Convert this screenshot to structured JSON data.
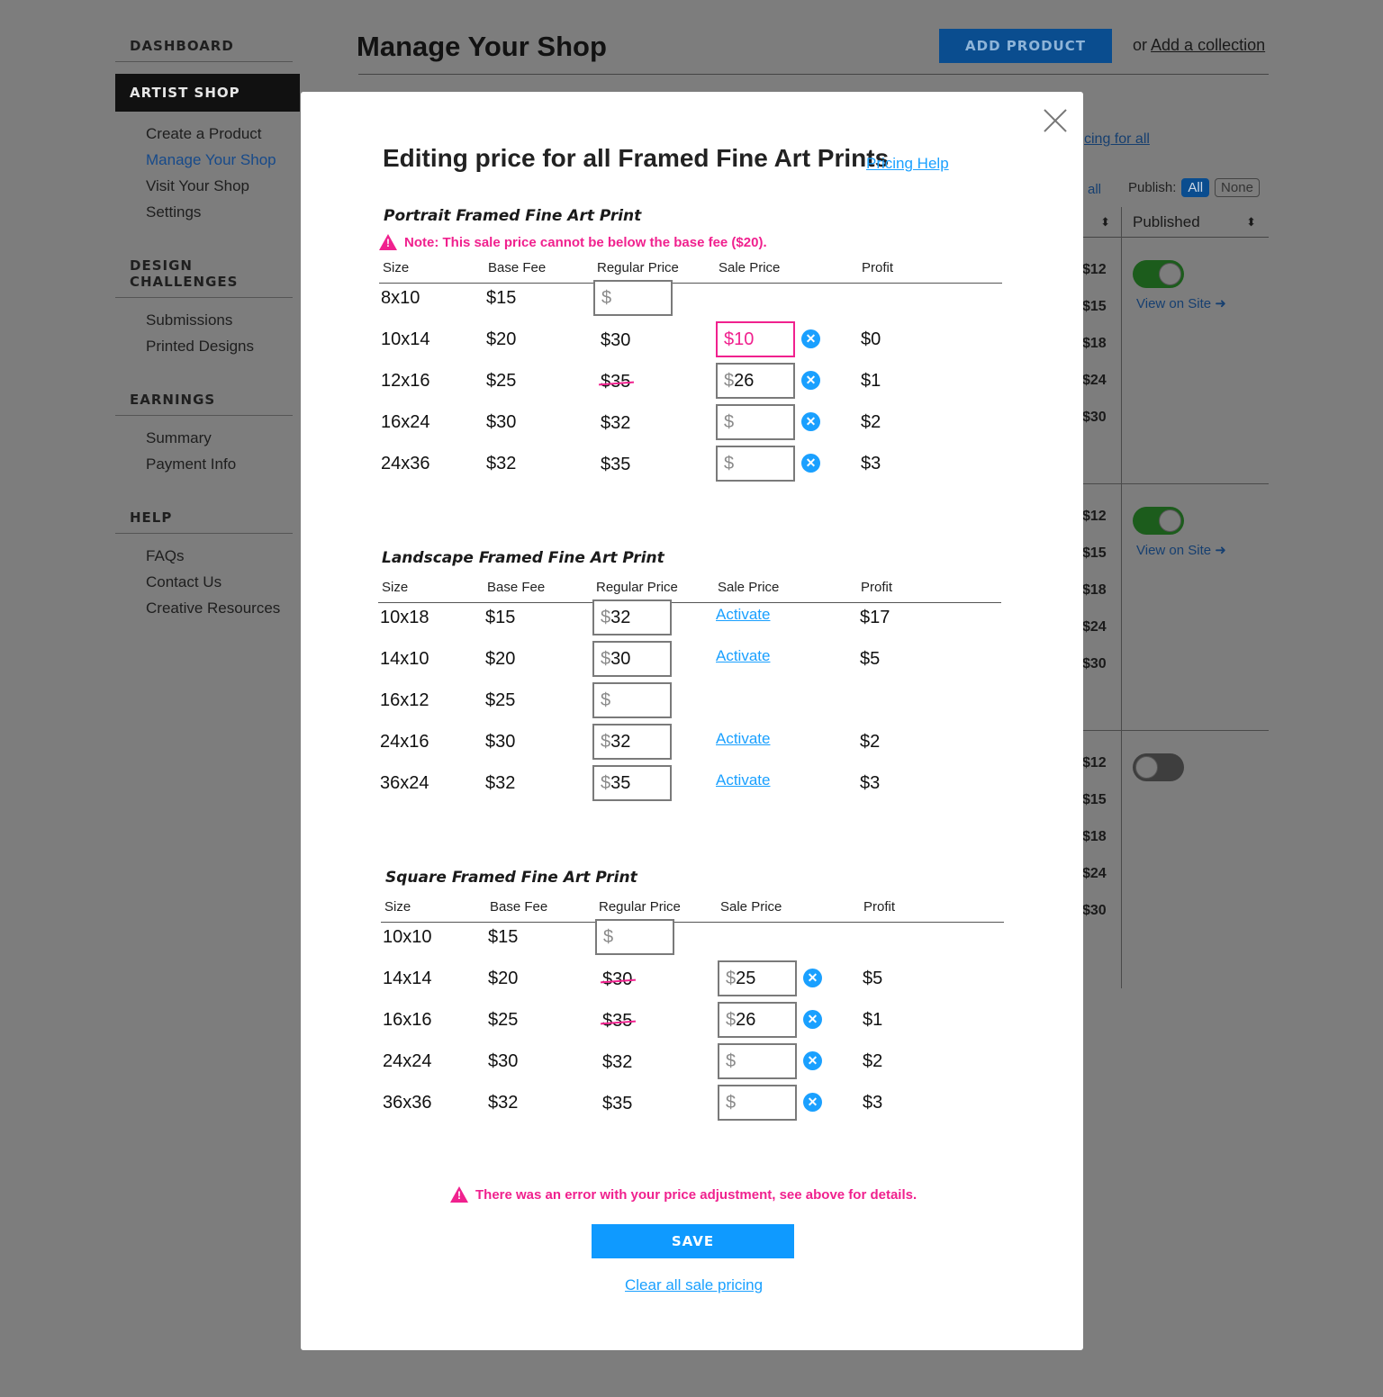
{
  "colors": {
    "accent": "#1aa0ff",
    "error": "#f0218e",
    "overlay": "#7d7d7d"
  },
  "sidebar": {
    "dashboard": "DASHBOARD",
    "artist_shop": "ARTIST SHOP",
    "artist_items": [
      "Create a Product",
      "Manage Your Shop",
      "Visit Your Shop",
      "Settings"
    ],
    "design_challenges": "DESIGN CHALLENGES",
    "design_items": [
      "Submissions",
      "Printed Designs"
    ],
    "earnings": "EARNINGS",
    "earnings_items": [
      "Summary",
      "Payment Info"
    ],
    "help": "HELP",
    "help_items": [
      "FAQs",
      "Contact Us",
      "Creative Resources"
    ]
  },
  "header": {
    "title": "Manage Your Shop",
    "add_product": "ADD PRODUCT",
    "or": "or",
    "add_collection": "Add a collection"
  },
  "background": {
    "pricing_link": "cing for all",
    "all_link": "all",
    "publish_label": "Publish:",
    "publish_all": "All",
    "publish_none": "None",
    "published_header": "Published",
    "view_on_site": "View on Site ➜",
    "prices": [
      "$12",
      "$15",
      "$18",
      "$24",
      "$30"
    ]
  },
  "modal": {
    "title": "Editing price for all Framed Fine Art Prints",
    "pricing_help": "Pricing Help",
    "columns": [
      "Size",
      "Base Fee",
      "Regular Price",
      "Sale Price",
      "Profit"
    ],
    "activate_label": "Activate",
    "sections": [
      {
        "title": "Portrait Framed Fine Art Print",
        "note": "Note: This sale price cannot be below the base fee ($20).",
        "rows": [
          {
            "size": "8x10",
            "base": "$15",
            "regular": "",
            "regular_input": true,
            "sale": null,
            "profit": ""
          },
          {
            "size": "10x14",
            "base": "$20",
            "regular": "$30",
            "sale": "10",
            "sale_error": true,
            "profit": "$0"
          },
          {
            "size": "12x16",
            "base": "$25",
            "regular": "$35",
            "struck": true,
            "sale": "26",
            "profit": "$1"
          },
          {
            "size": "16x24",
            "base": "$30",
            "regular": "$32",
            "sale": "",
            "profit": "$2"
          },
          {
            "size": "24x36",
            "base": "$32",
            "regular": "$35",
            "sale": "",
            "profit": "$3"
          }
        ]
      },
      {
        "title": "Landscape Framed Fine Art Print",
        "rows": [
          {
            "size": "10x18",
            "base": "$15",
            "regular": "32",
            "regular_input": true,
            "activate": true,
            "profit": "$17"
          },
          {
            "size": "14x10",
            "base": "$20",
            "regular": "30",
            "regular_input": true,
            "activate": true,
            "profit": "$5"
          },
          {
            "size": "16x12",
            "base": "$25",
            "regular": "",
            "regular_input": true,
            "activate": false,
            "profit": ""
          },
          {
            "size": "24x16",
            "base": "$30",
            "regular": "32",
            "regular_input": true,
            "activate": true,
            "profit": "$2"
          },
          {
            "size": "36x24",
            "base": "$32",
            "regular": "35",
            "regular_input": true,
            "activate": true,
            "profit": "$3"
          }
        ]
      },
      {
        "title": "Square Framed Fine Art Print",
        "rows": [
          {
            "size": "10x10",
            "base": "$15",
            "regular": "",
            "regular_input": true,
            "sale": null,
            "profit": ""
          },
          {
            "size": "14x14",
            "base": "$20",
            "regular": "$30",
            "struck": true,
            "sale": "25",
            "profit": "$5"
          },
          {
            "size": "16x16",
            "base": "$25",
            "regular": "$35",
            "struck": true,
            "sale": "26",
            "profit": "$1"
          },
          {
            "size": "24x24",
            "base": "$30",
            "regular": "$32",
            "sale": "",
            "profit": "$2"
          },
          {
            "size": "36x36",
            "base": "$32",
            "regular": "$35",
            "sale": "",
            "profit": "$3"
          }
        ]
      }
    ],
    "error_message": "There was an error with your price adjustment, see above for details.",
    "save": "SAVE",
    "clear_all": "Clear all sale pricing"
  }
}
